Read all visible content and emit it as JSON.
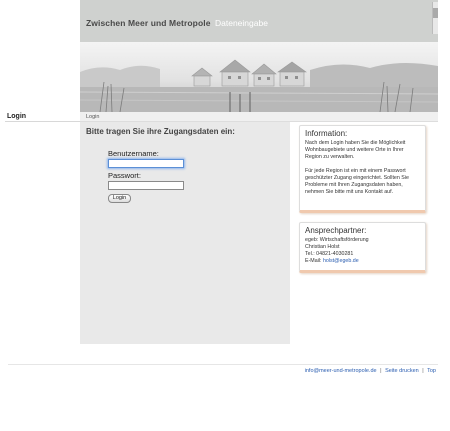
{
  "header": {
    "site_title": "Zwischen Meer und Metropole",
    "section_title": "Dateneingabe"
  },
  "left_nav": {
    "login_label": "Login"
  },
  "breadcrumb": "Login",
  "form": {
    "heading": "Bitte tragen Sie ihre Zugangsdaten ein:",
    "username_label": "Benutzername:",
    "username_value": "",
    "password_label": "Passwort:",
    "password_value": "",
    "submit_label": "Login"
  },
  "info_box": {
    "title": "Information:",
    "paragraph1": "Nach dem Login haben Sie die Möglichkeit Wohnbaugebiete und weitere Orte in Ihrer Region zu verwalten.",
    "paragraph2": "Für jede Region ist ein mit einem Passwort geschützter Zugang eingerichtet. Sollten Sie Probleme mit Ihren Zugangsdaten haben, nehmen Sie bitte mit uns Kontakt auf."
  },
  "contact_box": {
    "title": "Ansprechpartner:",
    "org": "egeb: Wirtschaftsförderung",
    "name": "Christian Holst",
    "phone": "Tel.: 04821-4030281",
    "email_label": "E-Mail:",
    "email": "holst@egeb.de"
  },
  "footer": {
    "email": "info@meer-und-metropole.de",
    "sep1": "|",
    "print_label": "Seite drucken",
    "sep2": "|",
    "top_label": "Top"
  },
  "colors": {
    "header_bg": "#cfd1cf",
    "main_bg": "#e9e9e9",
    "link": "#2a5db0",
    "box_accent": "#f0c9ae"
  }
}
